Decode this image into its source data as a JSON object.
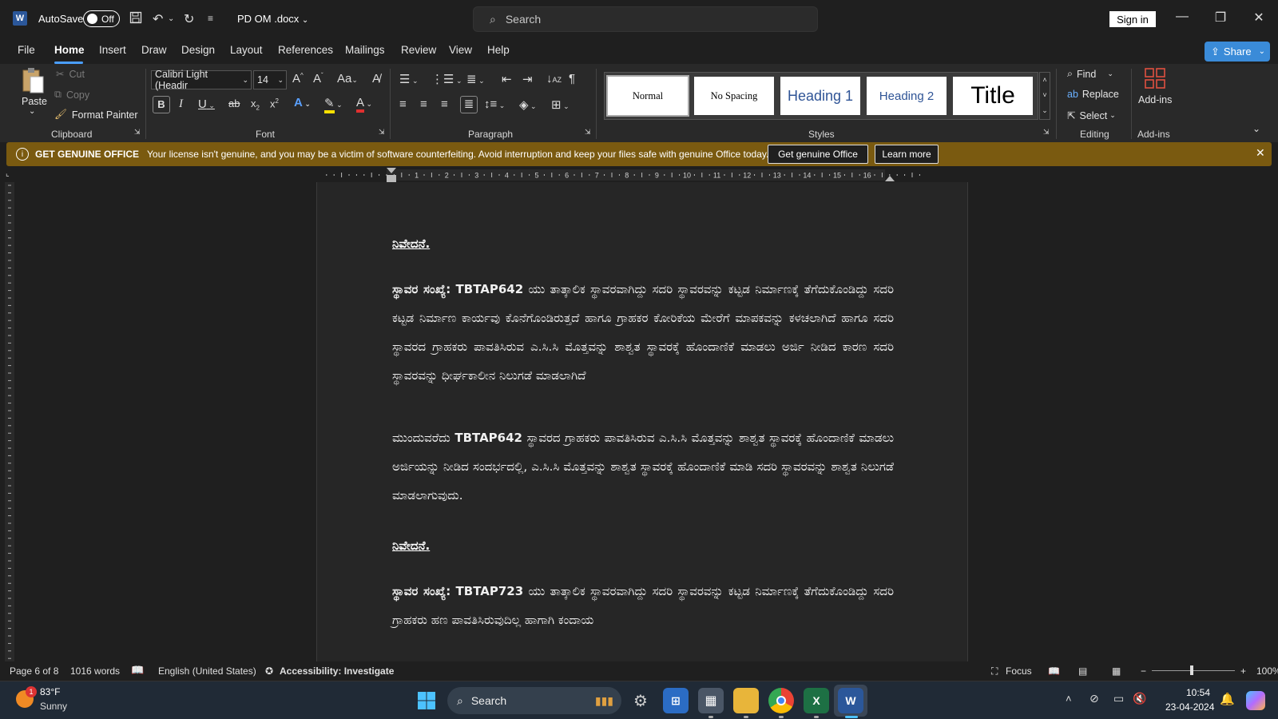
{
  "titlebar": {
    "autosave_label": "AutoSave",
    "autosave_state": "Off",
    "doc_name": "PD OM .docx",
    "search_placeholder": "Search",
    "sign_in": "Sign in"
  },
  "menu": {
    "tabs": [
      "File",
      "Home",
      "Insert",
      "Draw",
      "Design",
      "Layout",
      "References",
      "Mailings",
      "Review",
      "View",
      "Help"
    ],
    "active": "Home",
    "share": "Share"
  },
  "ribbon": {
    "clipboard": {
      "paste": "Paste",
      "cut": "Cut",
      "copy": "Copy",
      "format_painter": "Format Painter",
      "label": "Clipboard"
    },
    "font": {
      "name": "Calibri Light (Headir",
      "size": "14",
      "label": "Font"
    },
    "paragraph": {
      "label": "Paragraph"
    },
    "styles": {
      "items": [
        "Normal",
        "No Spacing",
        "Heading 1",
        "Heading 2",
        "Title"
      ],
      "label": "Styles"
    },
    "editing": {
      "find": "Find",
      "replace": "Replace",
      "select": "Select",
      "label": "Editing"
    },
    "addins": {
      "button": "Add-ins",
      "label": "Add-ins"
    }
  },
  "banner": {
    "title": "GET GENUINE OFFICE",
    "message": "Your license isn't genuine, and you may be a victim of software counterfeiting. Avoid interruption and keep your files safe with genuine Office today.",
    "primary_button": "Get genuine Office",
    "secondary_button": "Learn more"
  },
  "document": {
    "heading1": "ನಿವೇದನೆ.",
    "para1_lead": "ಸ್ಥಾವರ ಸಂಖ್ಯೆ:",
    "para1_code": "TBTAP642",
    "para1_rest": "ಯು ತಾತ್ಕಾಲಿಕ ಸ್ಥಾವರವಾಗಿದ್ದು ಸದರಿ ಸ್ಥಾವರವನ್ನು ಕಟ್ಟಡ ನಿರ್ಮಾಣಕ್ಕೆ ತೆಗೆದುಕೊಂಡಿದ್ದು ಸದರಿ ಕಟ್ಟಡ ನಿರ್ಮಾಣ ಕಾರ್ಯವು ಕೊನೆಗೊಂಡಿರುತ್ತದೆ ಹಾಗೂ ಗ್ರಾಹಕರ ಕೋರಿಕೆಯ ಮೇರೆಗೆ ಮಾಪಕವನ್ನು ಕಳಚಲಾಗಿದೆ ಹಾಗೂ ಸದರಿ ಸ್ಥಾವರದ ಗ್ರಾಹಕರು ಪಾವತಿಸಿರುವ ಎ.ಸಿ.ಸಿ ಮೊತ್ತವನ್ನು ಶಾಶ್ವತ ಸ್ಥಾವರಕ್ಕೆ ಹೊಂದಾಣಿಕೆ ಮಾಡಲು ಅರ್ಜಿ ನೀಡಿದ ಕಾರಣ ಸದರಿ ಸ್ಥಾವರವನ್ನು ಧೀರ್ಘಕಾಲೀನ ನಿಲುಗಡೆ ಮಾಡಲಾಗಿದೆ",
    "para2_lead": "ಮುಂದುವರೆದು",
    "para2_code": "TBTAP642",
    "para2_rest": "ಸ್ಥಾವರದ ಗ್ರಾಹಕರು ಪಾವತಿಸಿರುವ ಎ.ಸಿ.ಸಿ ಮೊತ್ತವನ್ನು ಶಾಶ್ವತ ಸ್ಥಾವರಕ್ಕೆ ಹೊಂದಾಣಿಕೆ ಮಾಡಲು ಅರ್ಜಿಯನ್ನು ನೀಡಿದ ಸಂದರ್ಭದಲ್ಲಿ, ಎ.ಸಿ.ಸಿ ಮೊತ್ತವನ್ನು ಶಾಶ್ವತ ಸ್ಥಾವರಕ್ಕೆ ಹೊಂದಾಣಿಕೆ ಮಾಡಿ ಸದರಿ ಸ್ಥಾವರವನ್ನು ಶಾಶ್ವತ ನಿಲುಗಡೆ ಮಾಡಲಾಗುವುದು.",
    "heading2": "ನಿವೇದನೆ.",
    "para3_lead": "ಸ್ಥಾವರ ಸಂಖ್ಯೆ:",
    "para3_code": "TBTAP723",
    "para3_rest": "ಯು ತಾತ್ಕಾಲಿಕ ಸ್ಥಾವರವಾಗಿದ್ದು ಸದರಿ ಸ್ಥಾವರವನ್ನು ಕಟ್ಟಡ ನಿರ್ಮಾಣಕ್ಕೆ ತೆಗೆದುಕೊಂಡಿದ್ದು ಸದರಿ ಗ್ರಾಹಕರು ಹಣ ಪಾವತಿಸಿರುವುದಿಲ್ಲ ಹಾಗಾಗಿ ಕಂದಾಯ"
  },
  "ruler": {
    "marks": [
      "1",
      "2",
      "3",
      "4",
      "5",
      "6",
      "7",
      "8",
      "9",
      "10",
      "11",
      "12",
      "13",
      "14",
      "15",
      "16"
    ]
  },
  "status": {
    "page": "Page 6 of 8",
    "words": "1016 words",
    "language": "English (United States)",
    "accessibility": "Accessibility: Investigate",
    "focus": "Focus",
    "zoom": "100%"
  },
  "taskbar": {
    "weather_temp": "83°F",
    "weather_desc": "Sunny",
    "weather_badge": "1",
    "search": "Search",
    "time": "10:54",
    "date": "23-04-2024"
  }
}
